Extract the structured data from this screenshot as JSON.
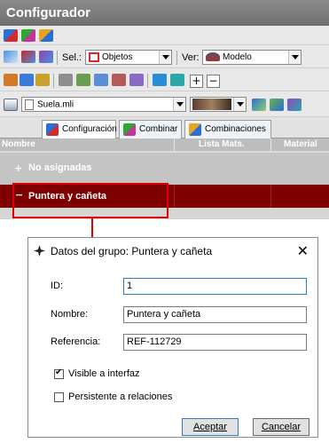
{
  "window": {
    "title": "Configurador"
  },
  "toolbar": {
    "sel_label": "Sel.:",
    "sel_value": "Objetos",
    "ver_label": "Ver:",
    "ver_value": "Modelo",
    "file_value": "Suela.mli",
    "plus": "+",
    "minus": "−"
  },
  "tabs": [
    {
      "label": "Configuración"
    },
    {
      "label": "Combinar"
    },
    {
      "label": "Combinaciones"
    }
  ],
  "grid": {
    "columns": [
      "Nombre",
      "Lista Mats.",
      "Material"
    ],
    "groups": [
      {
        "toggle": "+",
        "label": "No asignadas"
      },
      {
        "toggle": "−",
        "label": "Puntera y cañeta"
      }
    ]
  },
  "dialog": {
    "title": "Datos del grupo: Puntera y cañeta",
    "close": "✕",
    "fields": {
      "id_label": "ID:",
      "id_value": "1",
      "nombre_label": "Nombre:",
      "nombre_value": "Puntera y cañeta",
      "referencia_label": "Referencia:",
      "referencia_value": "REF-112729"
    },
    "visible_label": "Visible a interfaz",
    "visible_checked": true,
    "persistente_label": "Persistente a relaciones",
    "persistente_checked": false,
    "accept": "Aceptar",
    "cancel": "Cancelar"
  },
  "colors": {
    "selected_row": "#7f0000",
    "highlight": "#e00000",
    "accent": "#2a7bd6"
  }
}
